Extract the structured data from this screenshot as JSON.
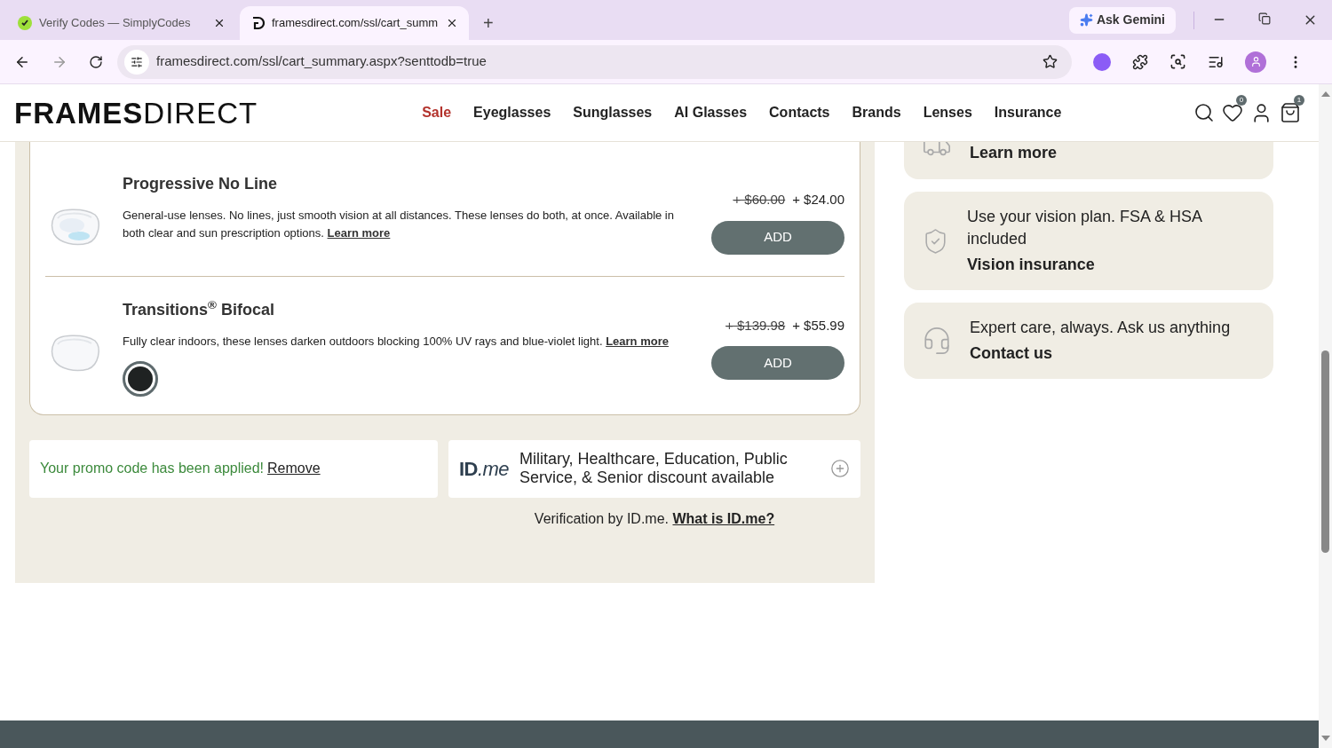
{
  "browser": {
    "tabs": [
      {
        "title": "Verify Codes — SimplyCodes",
        "kind": "simplycodes",
        "selected": false
      },
      {
        "title": "framesdirect.com/ssl/cart_summ",
        "kind": "framesdirect",
        "selected": true
      }
    ],
    "new_tab": "+",
    "ask_gemini": "Ask Gemini",
    "address": "framesdirect.com/ssl/cart_summary.aspx?senttodb=true"
  },
  "site": {
    "logo_bold": "FRAMES",
    "logo_light": "DIRECT",
    "nav": [
      {
        "label": "Sale",
        "kind": "sale"
      },
      {
        "label": "Eyeglasses",
        "kind": "normal"
      },
      {
        "label": "Sunglasses",
        "kind": "normal"
      },
      {
        "label": "AI Glasses",
        "kind": "normal"
      },
      {
        "label": "Contacts",
        "kind": "normal"
      },
      {
        "label": "Brands",
        "kind": "normal"
      },
      {
        "label": "Lenses",
        "kind": "normal"
      },
      {
        "label": "Insurance",
        "kind": "normal"
      }
    ],
    "wishlist_count": "0",
    "cart_count": "1"
  },
  "treatments": [
    {
      "name": "Progressive No Line",
      "description": "General-use lenses. No lines, just smooth vision at all distances. These lenses do both, at once. Available in both clear and sun prescription options.",
      "link": "Learn more",
      "old_price": "+ $60.00",
      "price": "+ $24.00",
      "button": "ADD",
      "kind": "tinted"
    },
    {
      "name": "Transitions$^{®}$ Bifocal",
      "description": "Fully clear indoors, these lenses darken outdoors blocking 100% UV rays and blue-violet light.",
      "link": "Learn more",
      "old_price": "+ $139.98",
      "price": "+ $55.99",
      "button": "ADD",
      "kind": "clear",
      "swatch": {
        "color": "#1f2222",
        "selected": true
      }
    }
  ],
  "promo": {
    "message": "Your promo code has been applied!",
    "link": "Remove"
  },
  "idme": {
    "logo_id": "ID",
    "logo_me": ".me",
    "offer": "Military, Healthcare, Education, Public Service, & Senior discount available",
    "verification": "Verification by ID.me.",
    "link": "What is ID.me?"
  },
  "perks": [
    {
      "kind": "truck",
      "link": "Learn more"
    },
    {
      "kind": "shield",
      "text": "Use your vision plan. FSA & HSA included",
      "link": "Vision insurance"
    },
    {
      "kind": "headset",
      "text": "Expert care, always. Ask us anything",
      "link": "Contact us"
    }
  ]
}
